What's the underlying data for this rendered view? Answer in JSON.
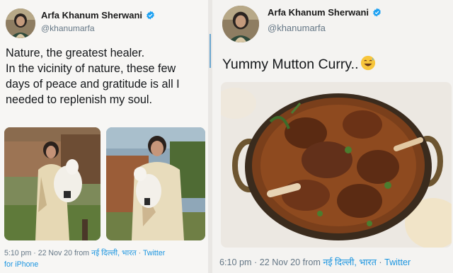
{
  "left_tweet": {
    "author": {
      "name": "Arfa Khanum Sherwani",
      "handle": "@khanumarfa"
    },
    "text_lines": [
      "Nature, the greatest healer.",
      "In the vicinity of nature, these few",
      "days of peace and gratitude is all I",
      "needed to replenish my soul."
    ],
    "meta": {
      "time": "5:10 pm",
      "sep1": " · ",
      "date": "22 Nov 20",
      "from": " from ",
      "location": "नई दिल्ली, भारत",
      "sep2": " · ",
      "source": "Twitter",
      "source_line2": "for iPhone"
    }
  },
  "right_tweet": {
    "author": {
      "name": "Arfa Khanum Sherwani",
      "handle": "@khanumarfa"
    },
    "text": "Yummy Mutton Curry..",
    "meta": {
      "time": "6:10 pm",
      "sep1": " · ",
      "date": "22 Nov 20",
      "from": " from ",
      "location": "नई दिल्ली, भारत",
      "sep2": " · ",
      "source": "Twitter"
    }
  },
  "colors": {
    "link": "#1b95e0",
    "verified": "#1da1f2",
    "meta_gray": "#657786"
  },
  "icons": {
    "verified": "verified-badge-icon",
    "emoji": "grinning-sweat-emoji-icon"
  }
}
